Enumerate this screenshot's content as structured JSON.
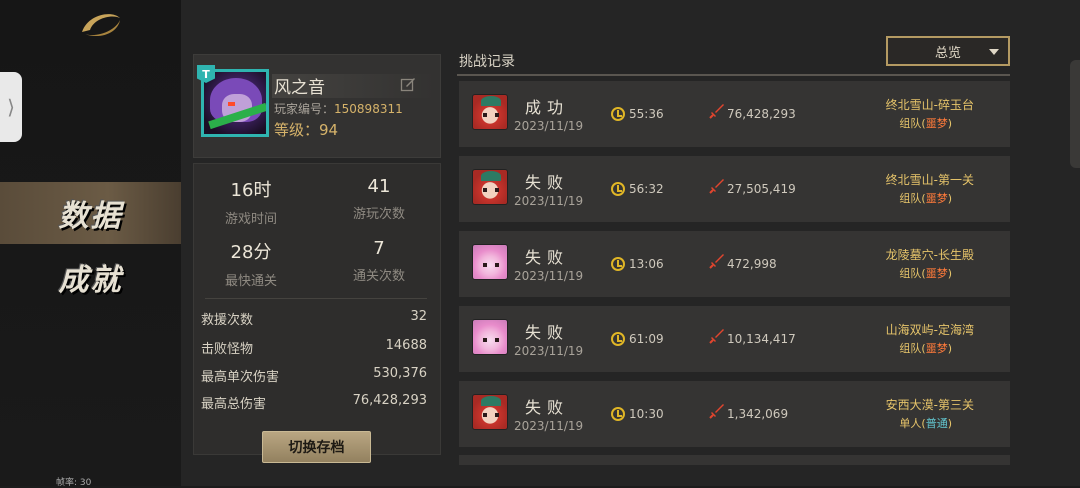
{
  "nav": {
    "items": [
      {
        "label": "数据",
        "active": true
      },
      {
        "label": "成就",
        "active": false
      }
    ],
    "fps_text": "帧率: 30"
  },
  "profile": {
    "rank_badge": "T",
    "name": "风之音",
    "id_label": "玩家编号：",
    "id_value": "150898311",
    "level_label": "等级：",
    "level_value": "94"
  },
  "stats": {
    "play_time_value": "16时",
    "play_time_label": "游戏时间",
    "play_count_value": "41",
    "play_count_label": "游玩次数",
    "fastest_value": "28分",
    "fastest_label": "最快通关",
    "clear_count_value": "7",
    "clear_count_label": "通关次数",
    "rows": [
      {
        "label": "救援次数",
        "value": "32"
      },
      {
        "label": "击败怪物",
        "value": "14688"
      },
      {
        "label": "最高单次伤害",
        "value": "530,376"
      },
      {
        "label": "最高总伤害",
        "value": "76,428,293"
      }
    ],
    "switch_button": "切换存档"
  },
  "records": {
    "title": "挑战记录",
    "filter_value": "总览",
    "items": [
      {
        "avatar": "red",
        "result": "成功",
        "date": "2023/11/19",
        "time": "55:36",
        "damage": "76,428,293",
        "map": "终北雪山-碎玉台",
        "mode": "组队",
        "difficulty": "噩梦"
      },
      {
        "avatar": "red",
        "result": "失败",
        "date": "2023/11/19",
        "time": "56:32",
        "damage": "27,505,419",
        "map": "终北雪山-第一关",
        "mode": "组队",
        "difficulty": "噩梦"
      },
      {
        "avatar": "pink",
        "result": "失败",
        "date": "2023/11/19",
        "time": "13:06",
        "damage": "472,998",
        "map": "龙陵墓穴-长生殿",
        "mode": "组队",
        "difficulty": "噩梦"
      },
      {
        "avatar": "pink",
        "result": "失败",
        "date": "2023/11/19",
        "time": "61:09",
        "damage": "10,134,417",
        "map": "山海双屿-定海湾",
        "mode": "组队",
        "difficulty": "噩梦"
      },
      {
        "avatar": "red",
        "result": "失败",
        "date": "2023/11/19",
        "time": "10:30",
        "damage": "1,342,069",
        "map": "安西大漠-第三关",
        "mode": "单人",
        "difficulty": "普通"
      }
    ]
  },
  "colors": {
    "accent_gold": "#d6b36a",
    "teal_frame": "#2fb4b0",
    "nightmare": "#ff7a3a",
    "normal": "#63c7d0"
  }
}
